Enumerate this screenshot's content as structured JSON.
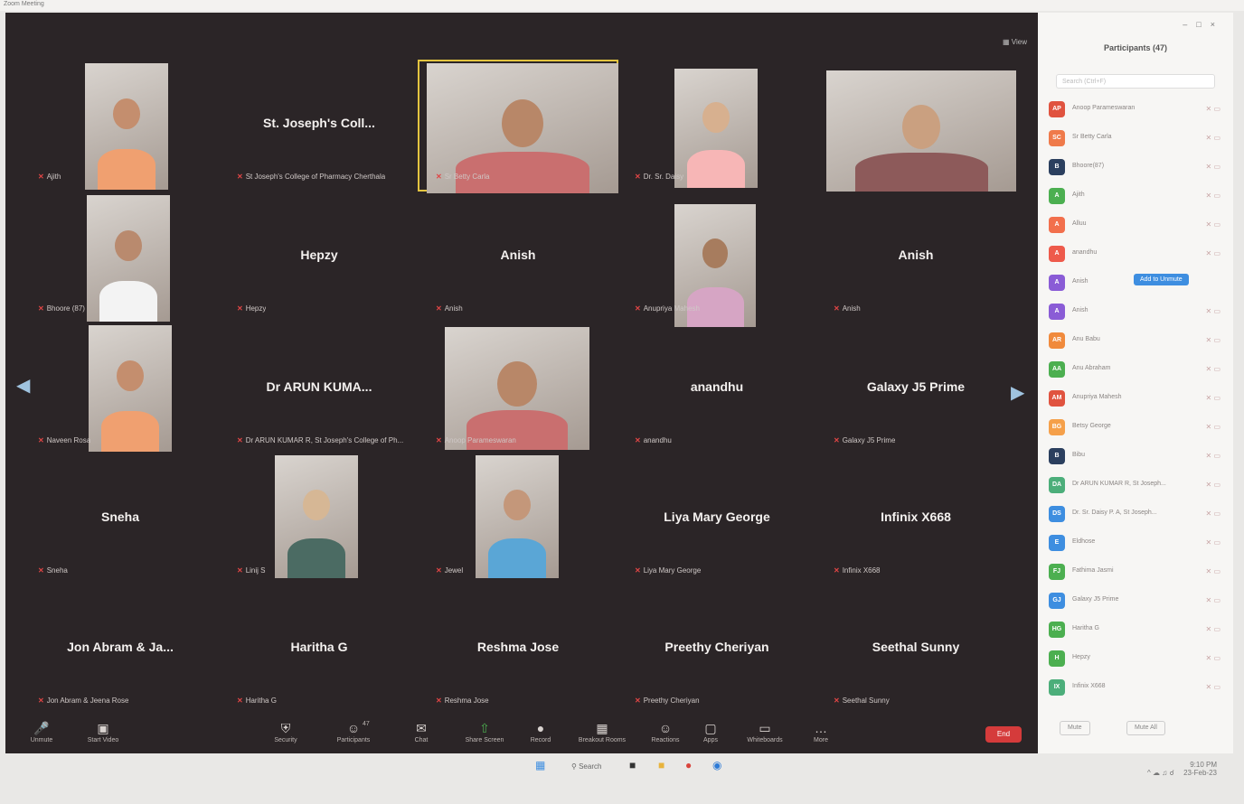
{
  "window": {
    "title": "Zoom Meeting"
  },
  "meeting": {
    "view_label": "View",
    "tiles": [
      {
        "caption": "Ajith",
        "center_name": "",
        "video": true
      },
      {
        "caption": "St Joseph's College of Pharmacy Cherthala",
        "center_name": "St. Joseph's Coll...",
        "video": false
      },
      {
        "caption": "Sr Betty Carla",
        "center_name": "",
        "video": true,
        "active": true
      },
      {
        "caption": "Dr. Sr. Daisy",
        "center_name": "",
        "video": true
      },
      {
        "caption": "",
        "center_name": "",
        "video": true
      },
      {
        "caption": "Bhoore (87)",
        "center_name": "",
        "video": true
      },
      {
        "caption": "Hepzy",
        "center_name": "Hepzy",
        "video": false
      },
      {
        "caption": "Anish",
        "center_name": "Anish",
        "video": false
      },
      {
        "caption": "Anupriya Mahesh",
        "center_name": "",
        "video": true
      },
      {
        "caption": "Anish",
        "center_name": "Anish",
        "video": false
      },
      {
        "caption": "Naveen Rosa",
        "center_name": "",
        "video": true
      },
      {
        "caption": "Dr ARUN KUMAR R, St Joseph's College of Ph...",
        "center_name": "Dr ARUN KUMA...",
        "video": false
      },
      {
        "caption": "Anoop Parameswaran",
        "center_name": "",
        "video": true
      },
      {
        "caption": "anandhu",
        "center_name": "anandhu",
        "video": false
      },
      {
        "caption": "Galaxy J5 Prime",
        "center_name": "Galaxy J5 Prime",
        "video": false
      },
      {
        "caption": "Sneha",
        "center_name": "Sneha",
        "video": false
      },
      {
        "caption": "Linij S",
        "center_name": "",
        "video": true
      },
      {
        "caption": "Jewel",
        "center_name": "",
        "video": true
      },
      {
        "caption": "Liya Mary George",
        "center_name": "Liya Mary George",
        "video": false
      },
      {
        "caption": "Infinix X668",
        "center_name": "Infinix X668",
        "video": false
      },
      {
        "caption": "Jon Abram & Jeena Rose",
        "center_name": "Jon Abram & Ja...",
        "video": false
      },
      {
        "caption": "Haritha G",
        "center_name": "Haritha G",
        "video": false
      },
      {
        "caption": "Reshma Jose",
        "center_name": "Reshma Jose",
        "video": false
      },
      {
        "caption": "Preethy Cheriyan",
        "center_name": "Preethy Cheriyan",
        "video": false
      },
      {
        "caption": "Seethal Sunny",
        "center_name": "Seethal Sunny",
        "video": false
      }
    ]
  },
  "toolbar": {
    "items": [
      "Unmute",
      "Start Video",
      "Security",
      "Participants",
      "Chat",
      "Share Screen",
      "Record",
      "Breakout Rooms",
      "Reactions",
      "Apps",
      "Whiteboards",
      "More"
    ],
    "participants_count": "47",
    "end_label": "End"
  },
  "panel": {
    "title": "Participants (47)",
    "search_placeholder": "Search (Ctrl+F)",
    "admit_label": "Add to Unmute",
    "participants": [
      {
        "initials": "AP",
        "name": "Anoop Parameswaran",
        "color": "#e0533f"
      },
      {
        "initials": "SC",
        "name": "Sr Betty Carla",
        "color": "#ef7a4a"
      },
      {
        "initials": "B",
        "name": "Bhoore(87)",
        "color": "#2b3f5e"
      },
      {
        "initials": "A",
        "name": "Ajith",
        "color": "#4caf50"
      },
      {
        "initials": "A",
        "name": "Alluu",
        "color": "#f26f4c"
      },
      {
        "initials": "A",
        "name": "anandhu",
        "color": "#ee5a4b"
      },
      {
        "initials": "A",
        "name": "Anish",
        "color": "#8a5cd6",
        "admit": true
      },
      {
        "initials": "A",
        "name": "Anish",
        "color": "#8a5cd6"
      },
      {
        "initials": "AR",
        "name": "Anu Babu",
        "color": "#f08a3c"
      },
      {
        "initials": "AA",
        "name": "Anu Abraham",
        "color": "#4caf50"
      },
      {
        "initials": "AM",
        "name": "Anupriya Mahesh",
        "color": "#e0533f"
      },
      {
        "initials": "BG",
        "name": "Betsy George",
        "color": "#f5a04a"
      },
      {
        "initials": "B",
        "name": "Bibu",
        "color": "#2b3f5e"
      },
      {
        "initials": "DA",
        "name": "Dr ARUN KUMAR R, St Joseph...",
        "color": "#4cae7a"
      },
      {
        "initials": "DS",
        "name": "Dr. Sr. Daisy P. A, St Joseph...",
        "color": "#3e8ee0"
      },
      {
        "initials": "E",
        "name": "Eldhose",
        "color": "#3e8ee0"
      },
      {
        "initials": "FJ",
        "name": "Fathima Jasmi",
        "color": "#4caf50"
      },
      {
        "initials": "GJ",
        "name": "Galaxy J5 Prime",
        "color": "#3e8ee0"
      },
      {
        "initials": "HG",
        "name": "Haritha G",
        "color": "#4caf50"
      },
      {
        "initials": "H",
        "name": "Hepzy",
        "color": "#4caf50"
      },
      {
        "initials": "IX",
        "name": "Infinix X668",
        "color": "#4cae7a"
      }
    ],
    "mute_all": "Mute",
    "more_label": "Mute All"
  },
  "taskbar": {
    "search_label": "Search",
    "time": "9:10 PM",
    "date": "23-Feb-23"
  }
}
